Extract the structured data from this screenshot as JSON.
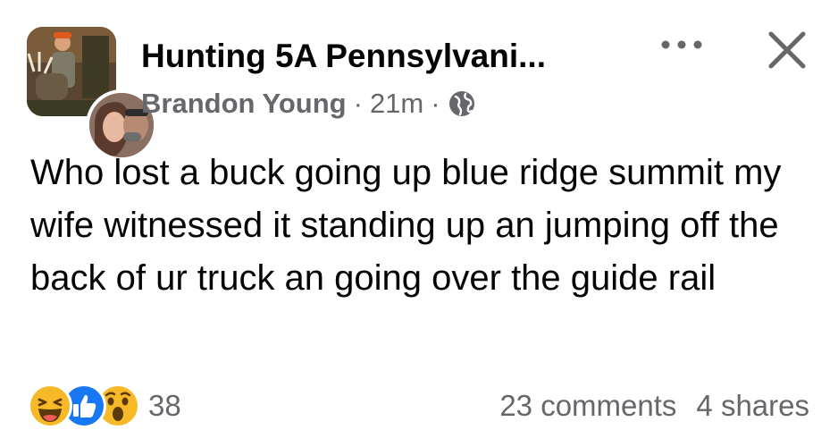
{
  "post": {
    "group_name": "Hunting 5A Pennsylvani...",
    "author": "Brandon Young",
    "separator": "·",
    "time": "21m",
    "audience_icon": "globe-icon",
    "text": "Who lost a buck going up blue ridge summit my wife witnessed it standing up an jumping off the back of ur truck an going over the guide rail"
  },
  "header": {
    "more_icon": "more-options-icon",
    "close_icon": "close-icon"
  },
  "footer": {
    "reactions": [
      "haha-reaction-icon",
      "like-reaction-icon",
      "wow-reaction-icon"
    ],
    "reaction_count": "38",
    "comments": "23 comments",
    "shares": "4 shares"
  },
  "colors": {
    "text_primary": "#050505",
    "text_secondary": "#65676b",
    "like_blue": "#1877f2",
    "emoji_yellow": "#f7b928"
  }
}
